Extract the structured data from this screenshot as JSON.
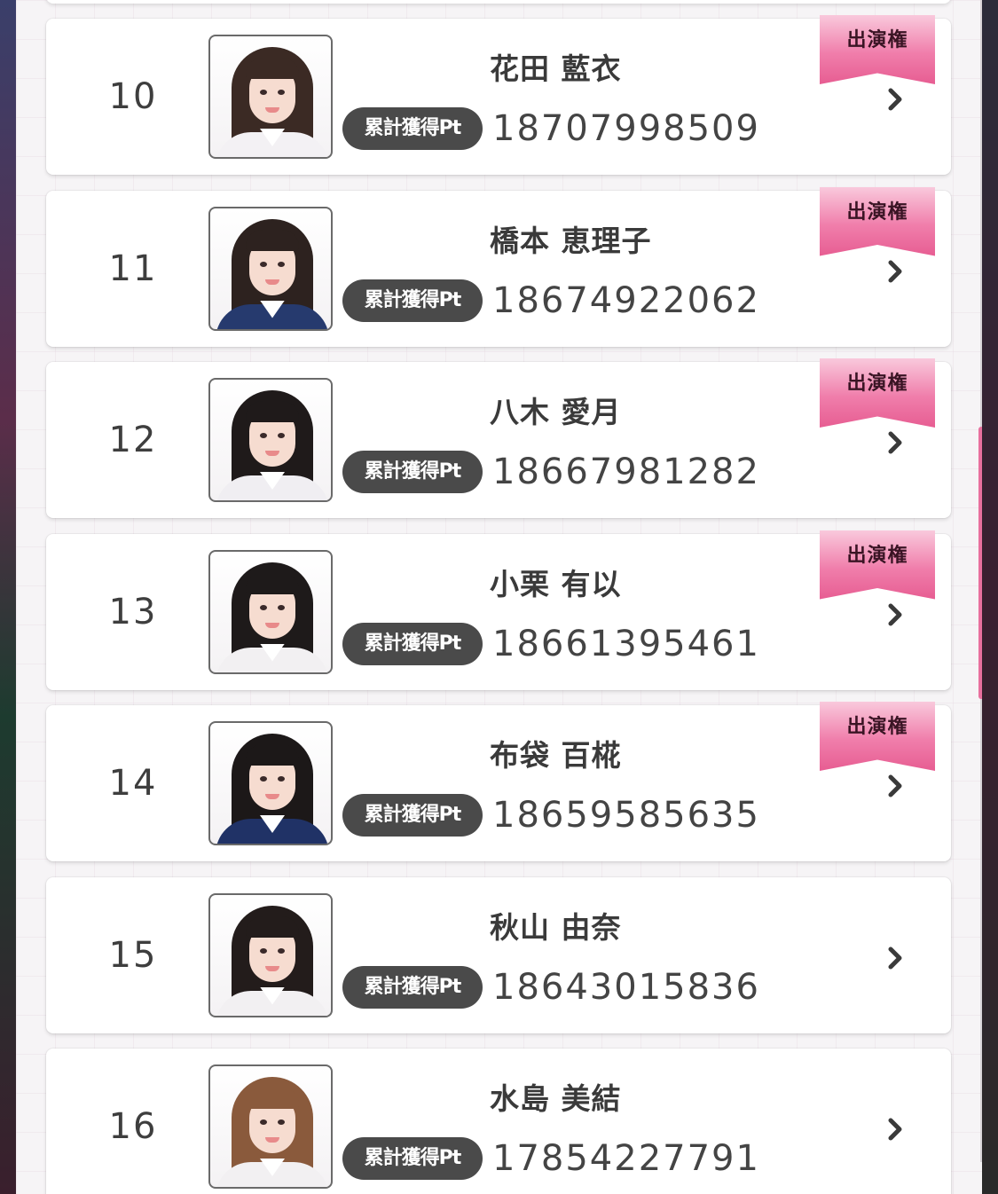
{
  "ribbon_label": "出演権",
  "points_label": "累計獲得Pt",
  "entries": [
    {
      "rank": "10",
      "name": "花田 藍衣",
      "points": "18707998509",
      "has_badge": true,
      "hair": "#3b2a24",
      "uniform": "#f3f1f4"
    },
    {
      "rank": "11",
      "name": "橋本 恵理子",
      "points": "18674922062",
      "has_badge": true,
      "hair": "#2d221f",
      "uniform": "#263a6e"
    },
    {
      "rank": "12",
      "name": "八木 愛月",
      "points": "18667981282",
      "has_badge": true,
      "hair": "#1f1a1a",
      "uniform": "#f0eef2"
    },
    {
      "rank": "13",
      "name": "小栗 有以",
      "points": "18661395461",
      "has_badge": true,
      "hair": "#1e1a1a",
      "uniform": "#f2f0f2"
    },
    {
      "rank": "14",
      "name": "布袋 百椛",
      "points": "18659585635",
      "has_badge": true,
      "hair": "#1c1818",
      "uniform": "#203266"
    },
    {
      "rank": "15",
      "name": "秋山 由奈",
      "points": "18643015836",
      "has_badge": false,
      "hair": "#231c1b",
      "uniform": "#f2f0f2"
    },
    {
      "rank": "16",
      "name": "水島 美結",
      "points": "17854227791",
      "has_badge": false,
      "hair": "#8a5a3c",
      "uniform": "#f2f0f2"
    }
  ],
  "scroll_position": 0.48
}
